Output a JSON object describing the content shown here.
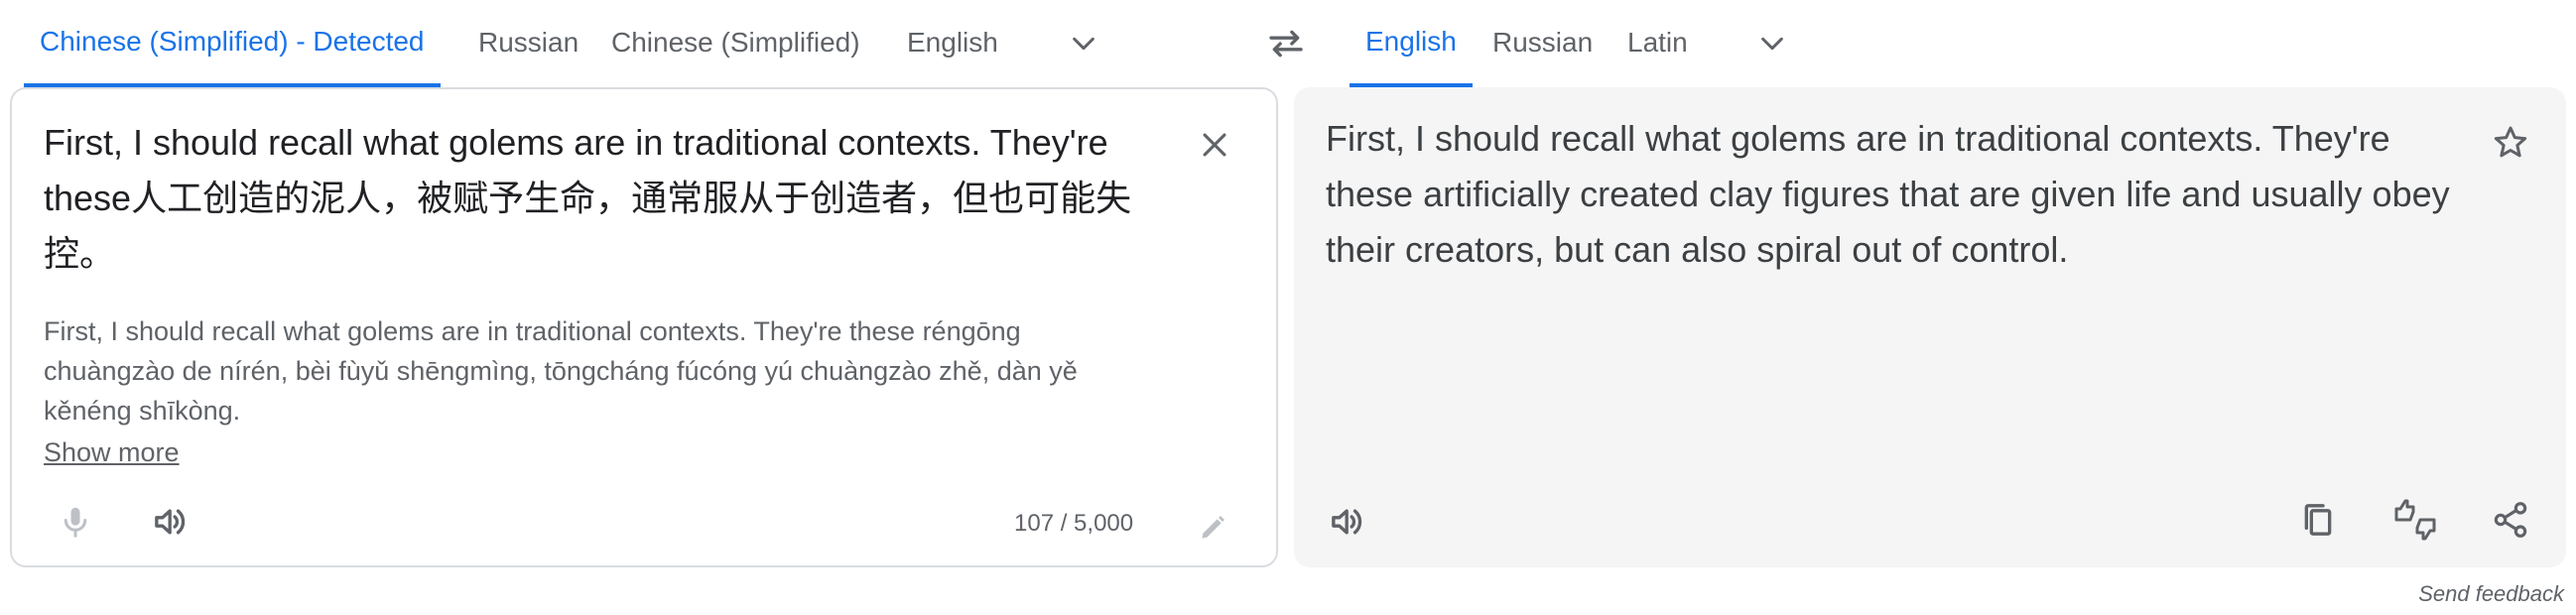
{
  "source_tabs": [
    {
      "label": "Chinese (Simplified) - Detected",
      "active": true
    },
    {
      "label": "Russian",
      "active": false
    },
    {
      "label": "Chinese (Simplified)",
      "active": false
    },
    {
      "label": "English",
      "active": false
    }
  ],
  "target_tabs": [
    {
      "label": "English",
      "active": true
    },
    {
      "label": "Russian",
      "active": false
    },
    {
      "label": "Latin",
      "active": false
    }
  ],
  "source": {
    "text": "First, I should recall what golems are in traditional contexts. They're these人工创造的泥人，被赋予生命，通常服从于创造者，但也可能失控。",
    "romanization": "First, I should recall what golems are in traditional contexts. They're these réngōng chuàngzào de nírén, bèi fùyǔ shēngmìng, tōngcháng fúcóng yú chuàngzào zhě, dàn yě kěnéng shīkòng.",
    "show_more": "Show more",
    "char_count": "107 / 5,000"
  },
  "target": {
    "text": "First, I should recall what golems are in traditional contexts. They're these artificially created clay figures that are given life and usually obey their creators, but can also spiral out of control."
  },
  "footer": {
    "send_feedback": "Send feedback"
  },
  "colors": {
    "accent": "#1a73e8",
    "text_primary": "#202124",
    "text_secondary": "#5f6368",
    "panel_border": "#dadce0",
    "target_panel_bg": "#f5f5f5",
    "icon_gray": "#5f6368",
    "icon_disabled": "#bdc1c6"
  },
  "icons": {
    "swap": "swap-icon",
    "more_languages": "chevron-down-icon",
    "clear": "close-icon",
    "mic": "mic-icon",
    "listen": "volume-icon",
    "edit": "pencil-icon",
    "star": "star-icon",
    "copy": "copy-icon",
    "rate": "thumbs-icon",
    "share": "share-icon"
  }
}
